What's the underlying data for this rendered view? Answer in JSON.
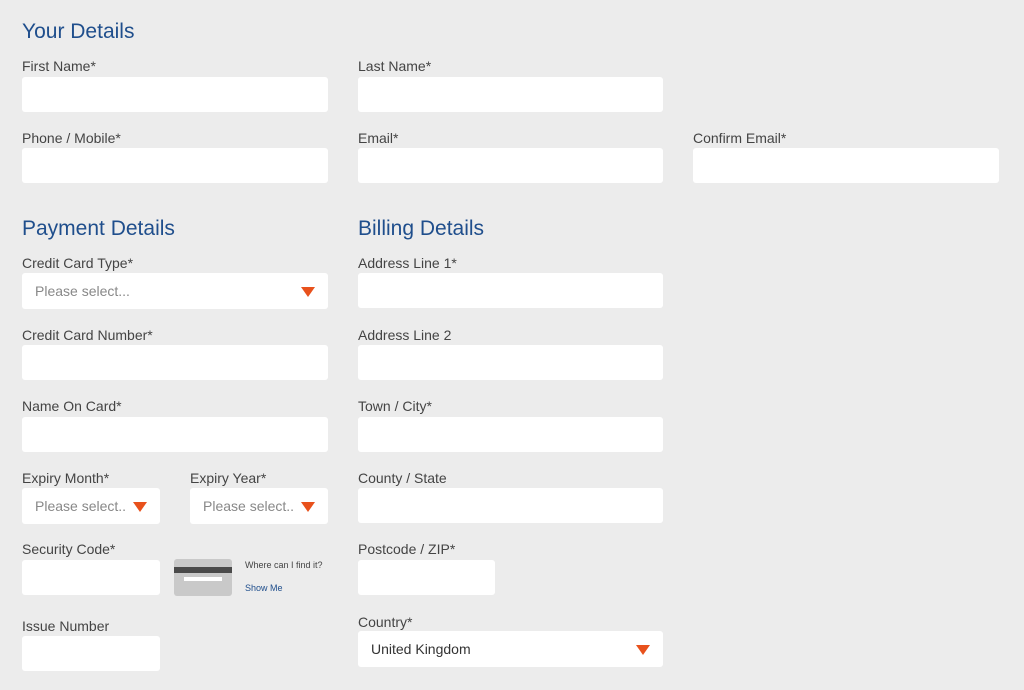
{
  "your_details": {
    "heading": "Your Details",
    "first_name_label": "First Name*",
    "last_name_label": "Last Name*",
    "phone_label": "Phone / Mobile*",
    "email_label": "Email*",
    "confirm_email_label": "Confirm Email*"
  },
  "payment": {
    "heading": "Payment Details",
    "card_type_label": "Credit Card Type*",
    "card_type_placeholder": "Please select...",
    "card_number_label": "Credit Card Number*",
    "name_on_card_label": "Name On Card*",
    "expiry_month_label": "Expiry Month*",
    "expiry_month_placeholder": "Please select...",
    "expiry_year_label": "Expiry Year*",
    "expiry_year_placeholder": "Please select...",
    "security_code_label": "Security Code*",
    "where_find": "Where can I find it?",
    "show_me": "Show Me",
    "issue_number_label": "Issue Number"
  },
  "billing": {
    "heading": "Billing Details",
    "address1_label": "Address Line 1*",
    "address2_label": "Address Line 2",
    "town_label": "Town / City*",
    "county_label": "County / State",
    "postcode_label": "Postcode / ZIP*",
    "country_label": "Country*",
    "country_value": "United Kingdom"
  },
  "colors": {
    "heading": "#1f4e8c",
    "arrow": "#e8511c",
    "background": "#ececec"
  }
}
